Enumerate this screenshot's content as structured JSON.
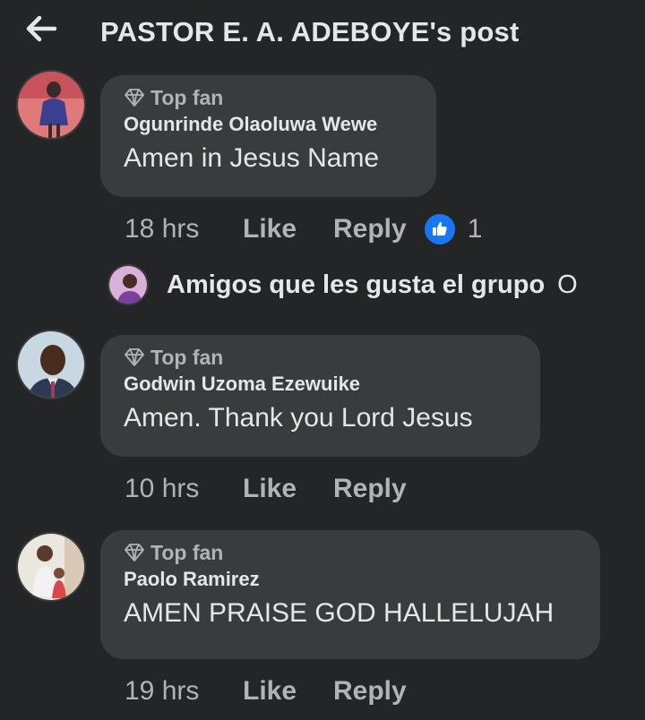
{
  "header": {
    "title": "PASTOR E. A. ADEBOYE's post",
    "back_icon": "arrow-left-icon"
  },
  "colors": {
    "background": "#242526",
    "bubble": "#3a3b3c",
    "text_primary": "#e4e6eb",
    "text_secondary": "#b0b3b8",
    "like_blue": "#1877f2"
  },
  "comments": [
    {
      "badge": "Top fan",
      "author": "Ogunrinde Olaoluwa Wewe",
      "text": "Amen in Jesus Name",
      "time": "18 hrs",
      "like_label": "Like",
      "reply_label": "Reply",
      "reaction_count": "1",
      "reply": {
        "author": "Amigos que les gusta el grupo",
        "preview": "O"
      }
    },
    {
      "badge": "Top fan",
      "author": "Godwin Uzoma Ezewuike",
      "text": "Amen. Thank you Lord Jesus",
      "time": "10 hrs",
      "like_label": "Like",
      "reply_label": "Reply"
    },
    {
      "badge": "Top fan",
      "author": "Paolo Ramirez",
      "text": "AMEN PRAISE GOD HALLELUJAH",
      "time": "19 hrs",
      "like_label": "Like",
      "reply_label": "Reply"
    }
  ]
}
